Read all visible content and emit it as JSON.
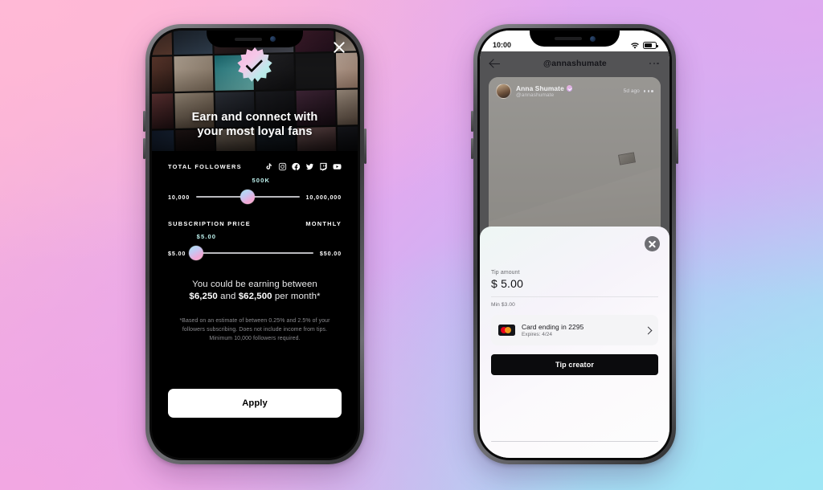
{
  "theme": {
    "bg_top_left": "#ffb9d6",
    "bg_top_right": "#dfa9f0",
    "bg_bottom_left": "#f2a7e2",
    "bg_bottom_right": "#9fe6f5",
    "accent_gradient_start": "#a9e6f2",
    "accent_gradient_end": "#fbb7c9",
    "dark_surface": "#000000",
    "value_text": "#bff3ef"
  },
  "left_phone": {
    "name": "creator-onboarding-screen",
    "close_icon": "close-icon",
    "verified_badge_icon": "verified-starburst-icon",
    "hero_title_line1": "Earn and connect with",
    "hero_title_line2": "your most loyal fans",
    "followers": {
      "label": "TOTAL FOLLOWERS",
      "value": "500K",
      "min_label": "10,000",
      "max_label": "10,000,000",
      "thumb_percent": 50,
      "socials": [
        "tiktok-icon",
        "instagram-icon",
        "facebook-icon",
        "twitter-icon",
        "twitch-icon",
        "youtube-icon"
      ]
    },
    "subscription": {
      "label": "SUBSCRIPTION PRICE",
      "period_label": "MONTHLY",
      "value": "$5.00",
      "min_label": "$5.00",
      "max_label": "$50.00",
      "thumb_percent": 3
    },
    "earnings": {
      "line1": "You could be earning between",
      "amount_low": "$6,250",
      "conjunction": " and ",
      "amount_high": "$62,500",
      "suffix": " per month*"
    },
    "disclaimer_line1": "*Based on an estimate of between 0.25% and 2.5% of your",
    "disclaimer_line2": "followers subscribing. Does not include income from tips.",
    "disclaimer_line3": "Minimum 10,000 followers required.",
    "apply_label": "Apply"
  },
  "right_phone": {
    "name": "creator-profile-tip-screen",
    "status_bar": {
      "time": "10:00",
      "wifi_icon": "wifi-icon",
      "battery_icon": "battery-icon"
    },
    "app_bar": {
      "back_icon": "back-arrow-icon",
      "title": "@annashumate",
      "more_icon": "more-options-icon"
    },
    "post": {
      "avatar": "creator-avatar",
      "display_name": "Anna Shumate",
      "verified_icon": "verified-badge-icon",
      "handle": "@annashumate",
      "timestamp": "5d ago",
      "more_icon": "post-more-icon"
    },
    "tip_sheet": {
      "close_icon": "close-icon",
      "amount_label": "Tip amount",
      "amount_value": "$ 5.00",
      "minimum_note": "Min $3.00",
      "payment_method": {
        "brand_icon": "mastercard-icon",
        "title": "Card ending in 2295",
        "subtitle": "Expires: 4/24",
        "chevron_icon": "chevron-right-icon"
      },
      "submit_label": "Tip creator",
      "home_indicator": "home-indicator"
    }
  }
}
